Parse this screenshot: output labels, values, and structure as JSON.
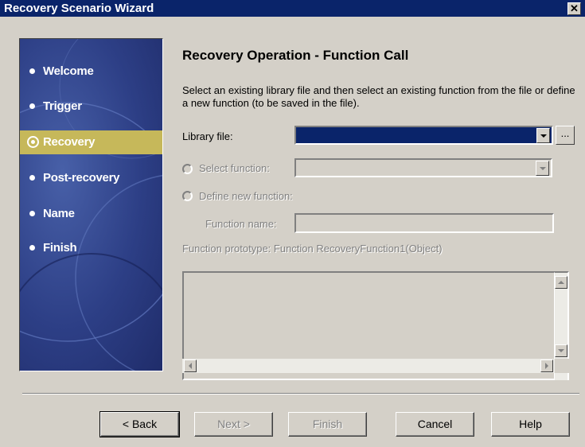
{
  "window": {
    "title": "Recovery Scenario Wizard",
    "close_glyph": "✕"
  },
  "sidebar": {
    "items": [
      {
        "label": "Welcome",
        "active": false
      },
      {
        "label": "Trigger",
        "active": false
      },
      {
        "label": "Recovery",
        "active": true
      },
      {
        "label": "Post-recovery",
        "active": false
      },
      {
        "label": "Name",
        "active": false
      },
      {
        "label": "Finish",
        "active": false
      }
    ],
    "active_color": "#c6b85a"
  },
  "main": {
    "heading": "Recovery Operation - Function Call",
    "description": "Select an existing library file and then select an existing function from the file or define a new function (to be saved in the file).",
    "library_file": {
      "label": "Library file:",
      "value": "",
      "browse_label": "..."
    },
    "select_function": {
      "label": "Select function:",
      "value": ""
    },
    "define_new_function": {
      "label": "Define new function:"
    },
    "function_name": {
      "label": "Function name:",
      "value": ""
    },
    "function_prototype": "Function prototype: Function RecoveryFunction1(Object)",
    "code_area": {
      "value": ""
    }
  },
  "buttons": {
    "back": "< Back",
    "next": "Next >",
    "finish": "Finish",
    "cancel": "Cancel",
    "help": "Help"
  },
  "colors": {
    "titlebar": "#0a246a",
    "dialog": "#d4d0c8",
    "selection": "#0a246a"
  }
}
